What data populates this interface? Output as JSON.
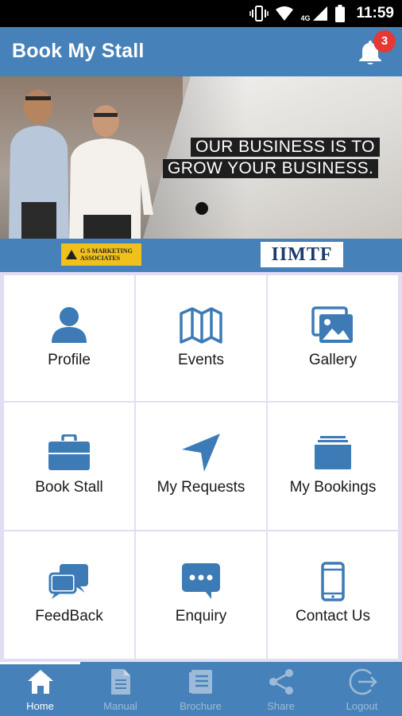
{
  "status_bar": {
    "time": "11:59",
    "network_label": "4G",
    "icons": [
      "vibrate-icon",
      "wifi-icon",
      "signal-icon",
      "battery-icon"
    ]
  },
  "app_bar": {
    "title": "Book My Stall",
    "notification_count": "3",
    "icon": "bell-icon"
  },
  "banner": {
    "tagline_line1": "OUR BUSINESS IS TO",
    "tagline_line2": "GROW YOUR BUSINESS."
  },
  "logos": {
    "gs_marketing_line1": "G S MARKETING",
    "gs_marketing_line2": "ASSOCIATES",
    "iimtf": "IIMTF"
  },
  "menu": {
    "items": [
      {
        "label": "Profile",
        "icon": "person-icon"
      },
      {
        "label": "Events",
        "icon": "map-icon"
      },
      {
        "label": "Gallery",
        "icon": "images-icon"
      },
      {
        "label": "Book Stall",
        "icon": "briefcase-icon"
      },
      {
        "label": "My Requests",
        "icon": "send-arrow-icon"
      },
      {
        "label": "My Bookings",
        "icon": "archive-icon"
      },
      {
        "label": "FeedBack",
        "icon": "chat-bubbles-icon"
      },
      {
        "label": "Enquiry",
        "icon": "chat-dots-icon"
      },
      {
        "label": "Contact Us",
        "icon": "phone-icon"
      }
    ]
  },
  "bottom_nav": {
    "items": [
      {
        "label": "Home",
        "icon": "home-icon",
        "active": true
      },
      {
        "label": "Manual",
        "icon": "document-icon",
        "active": false
      },
      {
        "label": "Brochure",
        "icon": "brochure-icon",
        "active": false
      },
      {
        "label": "Share",
        "icon": "share-icon",
        "active": false
      },
      {
        "label": "Logout",
        "icon": "logout-icon",
        "active": false
      }
    ]
  },
  "colors": {
    "primary": "#4682b9",
    "icon": "#3d7bb6",
    "grid_border": "#e3ddf4",
    "badge": "#e53935"
  }
}
